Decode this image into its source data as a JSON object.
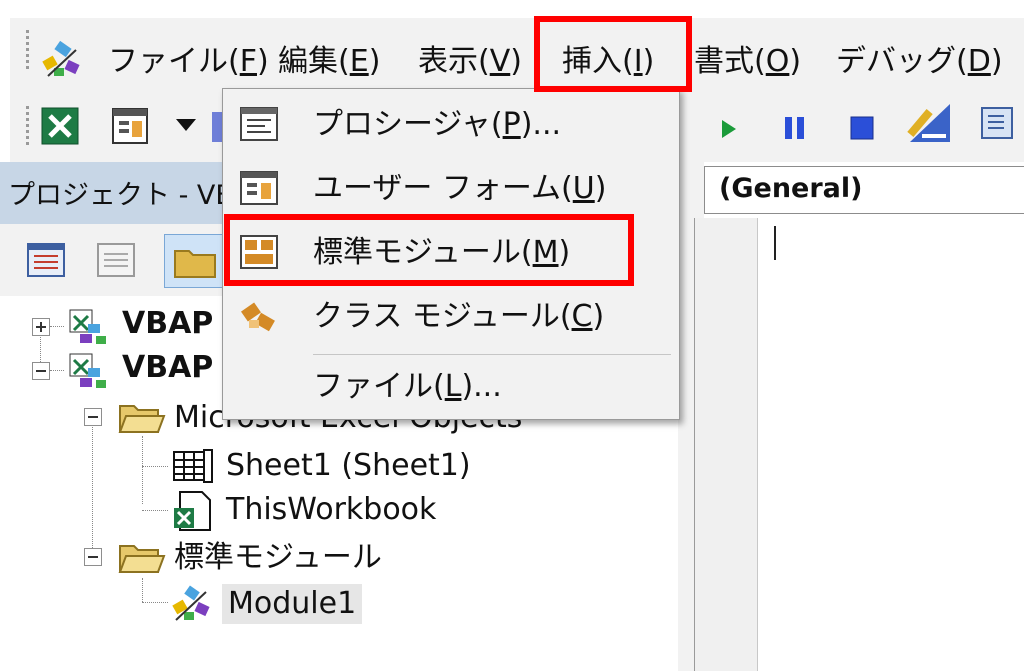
{
  "menubar": {
    "items": [
      {
        "label": "ファイル(",
        "key": "F",
        "tail": ")"
      },
      {
        "label": "編集(",
        "key": "E",
        "tail": ")"
      },
      {
        "label": "表示(",
        "key": "V",
        "tail": ")"
      },
      {
        "label": "挿入(",
        "key": "I",
        "tail": ")"
      },
      {
        "label": "書式(",
        "key": "O",
        "tail": ")"
      },
      {
        "label": "デバッグ(",
        "key": "D",
        "tail": ")"
      }
    ]
  },
  "insert_menu": {
    "items": [
      {
        "label": "プロシージャ(",
        "key": "P",
        "tail": ")..."
      },
      {
        "label": "ユーザー フォーム(",
        "key": "U",
        "tail": ")"
      },
      {
        "label": "標準モジュール(",
        "key": "M",
        "tail": ")"
      },
      {
        "label": "クラス モジュール(",
        "key": "C",
        "tail": ")"
      },
      {
        "label": "ファイル(",
        "key": "L",
        "tail": ")..."
      }
    ]
  },
  "project": {
    "title": "プロジェクト - VB",
    "tree": {
      "vbap1": "VBAP",
      "vbap2": "VBAP",
      "excel_objects": "Microsoft Excel Objects",
      "sheet1": "Sheet1 (Sheet1)",
      "thisworkbook": "ThisWorkbook",
      "std_modules": "標準モジュール",
      "module1": "Module1"
    }
  },
  "code": {
    "object_combo": "(General)"
  },
  "colors": {
    "highlight": "#ff0000",
    "panel_title": "#c7d6e6",
    "chrome": "#f2f2f2"
  }
}
